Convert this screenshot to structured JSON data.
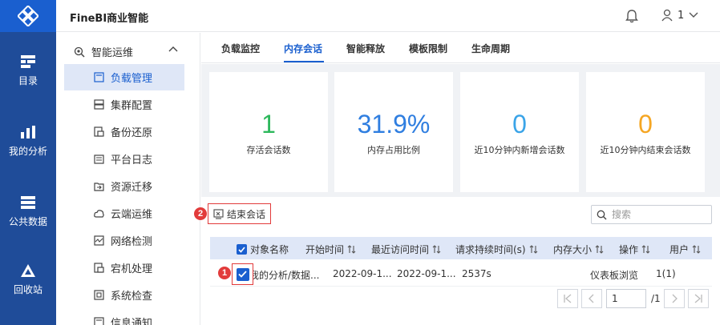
{
  "app": {
    "title": "FineBI商业智能",
    "user_name": "1"
  },
  "left_nav": [
    {
      "label": "目录",
      "icon": "catalog-icon"
    },
    {
      "label": "我的分析",
      "icon": "analysis-icon"
    },
    {
      "label": "公共数据",
      "icon": "public-data-icon"
    },
    {
      "label": "回收站",
      "icon": "recycle-bin-icon"
    }
  ],
  "sidebar": {
    "group_label": "智能运维",
    "items": [
      {
        "label": "负载管理",
        "active": true
      },
      {
        "label": "集群配置"
      },
      {
        "label": "备份还原"
      },
      {
        "label": "平台日志"
      },
      {
        "label": "资源迁移"
      },
      {
        "label": "云端运维"
      },
      {
        "label": "网络检测"
      },
      {
        "label": "宕机处理"
      },
      {
        "label": "系统检查"
      },
      {
        "label": "信息通知"
      }
    ]
  },
  "tabs": [
    {
      "label": "负载监控"
    },
    {
      "label": "内存会话",
      "active": true
    },
    {
      "label": "智能释放"
    },
    {
      "label": "模板限制"
    },
    {
      "label": "生命周期"
    }
  ],
  "stats": [
    {
      "value": "1",
      "caption": "存活会话数",
      "color": "#2db85c"
    },
    {
      "value": "31.9%",
      "caption": "内存占用比例",
      "color": "#2f7ee0"
    },
    {
      "value": "0",
      "caption": "近10分钟内新增会话数",
      "color": "#3aa4e8"
    },
    {
      "value": "0",
      "caption": "近10分钟内结束会话数",
      "color": "#f5a623"
    }
  ],
  "toolbar": {
    "end_session_label": "结束会话",
    "search_placeholder": "搜索"
  },
  "badges": {
    "first": "1",
    "second": "2"
  },
  "table": {
    "columns": [
      "对象名称",
      "开始时间",
      "最近访问时间",
      "请求持续时间(s)",
      "内存大小",
      "操作",
      "用户"
    ],
    "rows": [
      {
        "name": "我的分析/数据...",
        "start": "2022-09-1...",
        "last_access": "2022-09-1...",
        "duration": "2537s",
        "memory": "",
        "operation": "仪表板浏览",
        "user": "1(1)"
      }
    ]
  },
  "pagination": {
    "current": "1",
    "total": "/1"
  },
  "colors": {
    "brand": "#1a5fcf",
    "nav_bg": "#1f4c99",
    "highlight": "#e23b3b"
  }
}
